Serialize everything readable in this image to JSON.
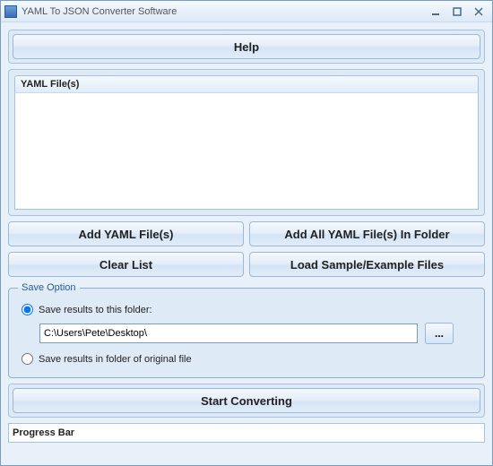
{
  "window": {
    "title": "YAML To JSON Converter Software"
  },
  "help_button": "Help",
  "files": {
    "header": "YAML File(s)"
  },
  "buttons": {
    "add_files": "Add YAML File(s)",
    "add_folder": "Add All YAML File(s) In Folder",
    "clear_list": "Clear List",
    "load_sample": "Load Sample/Example Files",
    "start": "Start Converting",
    "browse": "..."
  },
  "save_option": {
    "legend": "Save Option",
    "radio_to_folder": "Save results to this folder:",
    "radio_original": "Save results in folder of original file",
    "path_value": "C:\\Users\\Pete\\Desktop\\",
    "selected": "to_folder"
  },
  "progress": {
    "label": "Progress Bar"
  }
}
